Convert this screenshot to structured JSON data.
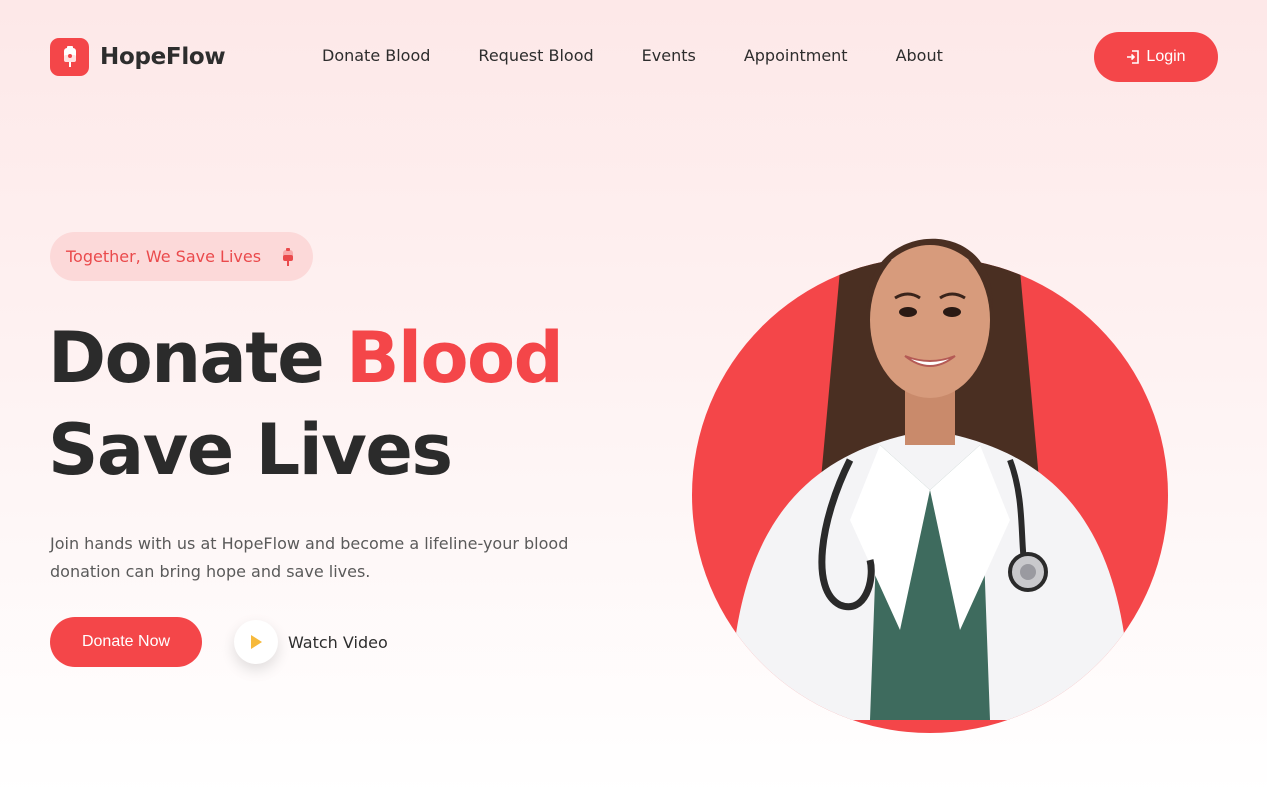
{
  "brand": {
    "name": "HopeFlow",
    "icon": "blood-bag-icon",
    "accent_color": "#f44649"
  },
  "nav": {
    "items": [
      {
        "label": "Donate Blood"
      },
      {
        "label": "Request Blood"
      },
      {
        "label": "Events"
      },
      {
        "label": "Appointment"
      },
      {
        "label": "About"
      }
    ]
  },
  "header": {
    "login_label": "Login",
    "login_icon": "sign-in-icon"
  },
  "hero": {
    "badge_text": "Together, We Save Lives",
    "badge_icon": "blood-bag-icon",
    "headline_word1": "Donate",
    "headline_word2": "Blood",
    "headline_line2": "Save Lives",
    "description": "Join hands with us at HopeFlow and become a lifeline-your blood donation can bring hope and save lives.",
    "primary_cta": "Donate Now",
    "secondary_cta": "Watch Video",
    "secondary_icon": "play-icon",
    "image": "doctor-portrait"
  }
}
